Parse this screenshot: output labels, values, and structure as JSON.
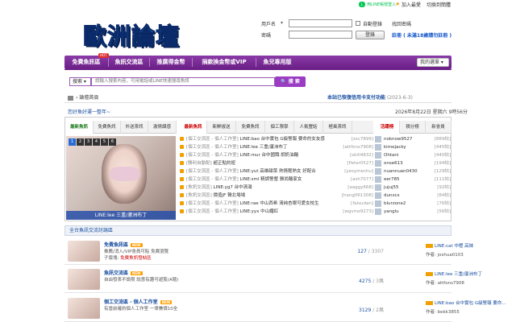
{
  "topbar": {
    "line_login": "用LINE帳號登入",
    "bookmark": "加入最愛",
    "switch_font": "切換到簡體"
  },
  "header": {
    "logo": "歐洲論壇"
  },
  "login": {
    "user_label": "用戶名",
    "user_select": "▾",
    "password_label": "密碼",
    "remember": "自動登錄",
    "forgot": "找回密碼",
    "login_button": "登錄",
    "register": "註冊 ( 未滿18歲請勿註冊 )"
  },
  "nav": {
    "items": [
      "免費魚訊區",
      "魚訊交流區",
      "推廣得金幣",
      "捐款換金幣或VIP",
      "魚兒專用版"
    ],
    "hot": "HOT",
    "my_menu": "我的選單"
  },
  "search": {
    "type": "搜索",
    "placeholder": "請輸入搜索內容，可用電話或LINE快速搜尋魚訊",
    "button": "搜 索"
  },
  "notice": {
    "text": "本站已恢復信用卡支付功能",
    "date": "(2023-6-3)"
  },
  "breadcrumb": {
    "label": "論壇首頁"
  },
  "welcome": {
    "text": "您好魚好運一整年~",
    "datetime": "2026年8月22日 星期六 9時56分"
  },
  "tabs_left": [
    "最新魚訊",
    "免費魚訊",
    "外送茶訊",
    "激情謀感"
  ],
  "tabs_mid": [
    "最新魚訊",
    "新鮮拔送",
    "免費魚訊",
    "個工限學",
    "人氣豐話",
    "極風茶訊"
  ],
  "tabs_right": [
    "活躍榜",
    "積分榜",
    "新會員"
  ],
  "slider": {
    "numbers": [
      "1",
      "2",
      "3",
      "4",
      "5",
      "6"
    ],
    "caption": "LINE:lee 三重/蘆洲布丁"
  },
  "threads": [
    {
      "cat": "[個工交流區 - 個人工作室]",
      "title": "LINE:bao 台中實包 G級警報 要命的女友感",
      "author": "[zxc7899]"
    },
    {
      "cat": "[個工交流區 - 個人工作室]",
      "title": "LINE:lee 三重/蘆洲布丁",
      "author": "[attfons7908]"
    },
    {
      "cat": "[個工交流區 - 個人工作室]",
      "title": "LINE:mur 台中國職 調奶油酪",
      "author": "[skill4832]"
    },
    {
      "cat": "[勝利自動配]",
      "title": "超正點約妞",
      "author": "[Peter0527]"
    },
    {
      "cat": "[個工交流區 - 個人工作室]",
      "title": "LINE:yut 高雄甜菜 熱情輕熟女 好配合",
      "author": "[yesymechu]"
    },
    {
      "cat": "[個工交流區 - 個人工作室]",
      "title": "LINE:sml 精調警整 雅尚酪家女",
      "author": "[ash7077]"
    },
    {
      "cat": "[魚訊交流區]",
      "title": "LINE:yg7 台中清湯",
      "author": "[aaggy668]"
    },
    {
      "cat": "[魚訊交流區]",
      "title": "價值JF 聲北場場",
      "author": "[hang061308]"
    },
    {
      "cat": "[個工交流區 - 個人工作室]",
      "title": "LINE:rae 中山西希 清純杏眼可愛女校生",
      "author": "[falsudan]"
    },
    {
      "cat": "[個工交流區 - 個人工作室]",
      "title": "LINE:yyx 中山媚紅",
      "author": "[wgvmz9273]"
    }
  ],
  "rank": [
    {
      "name": "noknow9527",
      "count": "[889帖]"
    },
    {
      "name": "kimejacky",
      "count": "[445帖]"
    },
    {
      "name": "Ohtani",
      "count": "[440帖]"
    },
    {
      "name": "onse613",
      "count": "[194帖]"
    },
    {
      "name": "nuannuan0430",
      "count": "[129帖]"
    },
    {
      "name": "eer785",
      "count": "[111帖]"
    },
    {
      "name": "jujuj55",
      "count": "[92帖]"
    },
    {
      "name": "dunxcs",
      "count": "[84帖]"
    },
    {
      "name": "blurzone2",
      "count": "[76帖]"
    },
    {
      "name": "yanglu",
      "count": "[56帖]"
    }
  ],
  "forum_head": "全台魚訊交流討論區",
  "forums": [
    {
      "name": "免費魚訊區",
      "badge": "NEW",
      "desc": "推薦/消入/VIP會員可貼 免費瀏覽",
      "sub_label": "子版塊:",
      "sub": "免費魚訊發帖區",
      "stat": "127",
      "stat_total": "/ 3307",
      "last_title": "LINE:cat 中壢 高妹",
      "last_by": "作者: joshua0103"
    },
    {
      "name": "魚訊交流區",
      "badge": "NEW",
      "desc": "自由發表不設限 說意有趣可遊覧(A隨)",
      "sub_label": "",
      "sub": "",
      "stat": "4275",
      "stat_total": "/ 3萬",
      "last_title": "LINE:lee 三重/蘆洲布丁",
      "last_by": "作者: attfons7908"
    },
    {
      "name": "個工交流區 - 個人工作室",
      "badge": "NEW",
      "desc": "有當前確約個人工作室 一律兼價10全",
      "sub_label": "",
      "sub": "",
      "stat": "3129",
      "stat_total": "/ 2萬",
      "last_title": "LINE:bao 台中實包 G級警報 要命...",
      "last_by": "作者: bekk3855"
    }
  ],
  "colors": {
    "nav": "#7a2c96",
    "accent_blue": "#1a4fa0",
    "hot_red": "#e03030",
    "line_green": "#06c755"
  }
}
